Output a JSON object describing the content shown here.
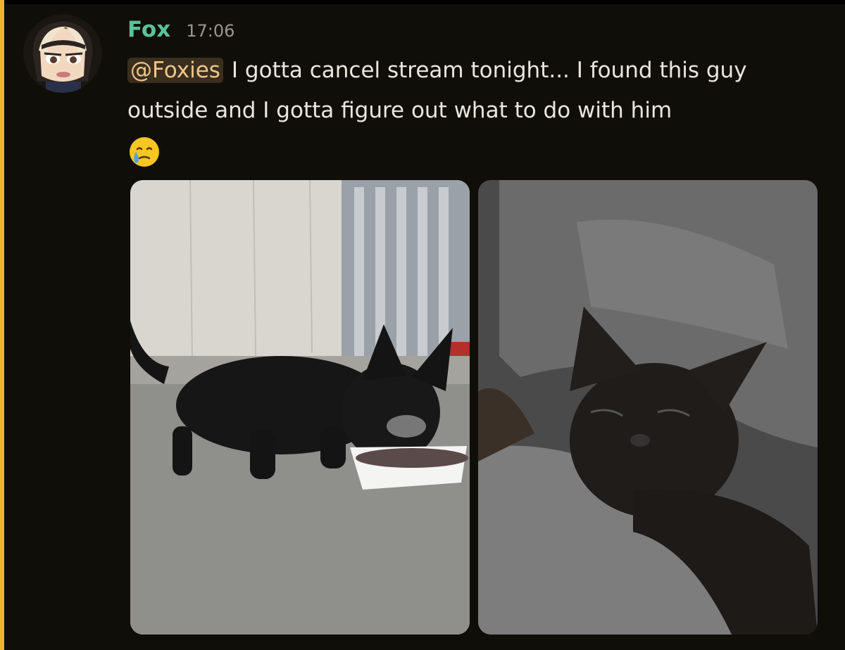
{
  "message": {
    "author": "Fox",
    "timestamp": "17:06",
    "mention": "@Foxies",
    "text": "I gotta cancel stream tonight... I found this guy outside and I gotta figure out what to do with him",
    "emoji": "face-holding-back-tears-icon"
  },
  "attachments": [
    {
      "name": "kitten-eating-photo"
    },
    {
      "name": "kitten-sleeping-photo"
    }
  ],
  "colors": {
    "background": "#100e08",
    "accent_bar": "#f0b232",
    "author": "#59c397",
    "timestamp": "#9a968c",
    "text": "#e9e6dd",
    "mention_bg": "#3a2f1e",
    "mention_text": "#f0c58a"
  }
}
